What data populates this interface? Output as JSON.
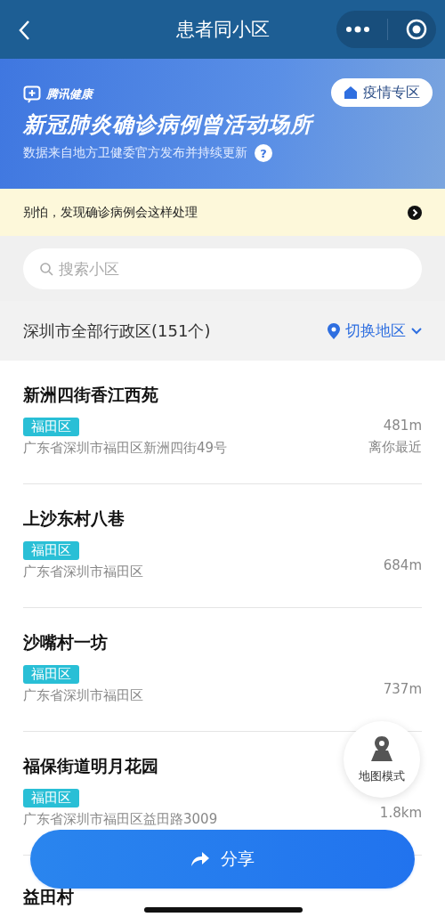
{
  "nav": {
    "title": "患者同小区"
  },
  "banner": {
    "brand": "腾讯健康",
    "button": "疫情专区",
    "title": "新冠肺炎确诊病例曾活动场所",
    "subtitle": "数据来自地方卫健委官方发布并持续更新",
    "help": "?"
  },
  "notice": {
    "text": "别怕，发现确诊病例会这样处理"
  },
  "search": {
    "placeholder": "搜索小区"
  },
  "region": {
    "label": "深圳市全部行政区(151个)",
    "switch": "切换地区"
  },
  "places": [
    {
      "name": "新洲四街香江西苑",
      "tag": "福田区",
      "address": "广东省深圳市福田区新洲四街49号",
      "distance": "481m",
      "note": "离你最近"
    },
    {
      "name": "上沙东村八巷",
      "tag": "福田区",
      "address": "广东省深圳市福田区",
      "distance": "684m"
    },
    {
      "name": "沙嘴村一坊",
      "tag": "福田区",
      "address": "广东省深圳市福田区",
      "distance": "737m"
    },
    {
      "name": "福保街道明月花园",
      "tag": "福田区",
      "address": "广东省深圳市福田区益田路3009",
      "distance": "1.8km"
    },
    {
      "name": "益田村"
    }
  ],
  "map_button": {
    "label": "地图模式"
  },
  "share_button": {
    "label": "分享"
  }
}
